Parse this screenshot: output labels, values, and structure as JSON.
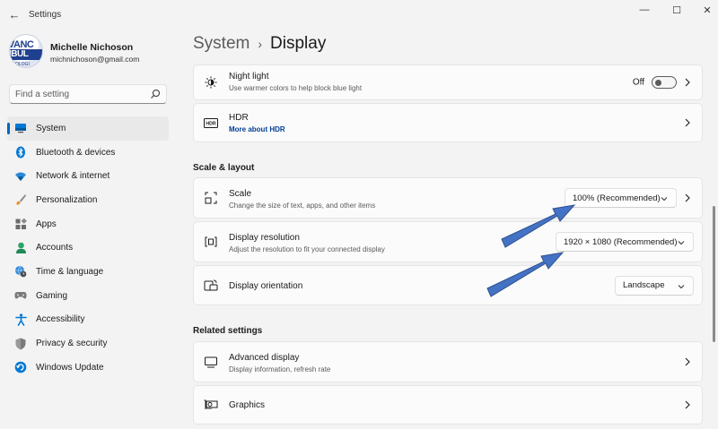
{
  "window": {
    "title": "Settings",
    "back_glyph": "←",
    "minimize_glyph": "—",
    "maximize_glyph": "☐",
    "close_glyph": "✕"
  },
  "profile": {
    "name": "Michelle Nichoson",
    "email": "michnichoson@gmail.com",
    "avatar_line1": "VANC",
    "avatar_line2": "IBUL",
    "avatar_line3": "OLOGI"
  },
  "search": {
    "placeholder": "Find a setting"
  },
  "sidebar": {
    "items": [
      {
        "label": "System",
        "icon": "monitor-icon",
        "active": true
      },
      {
        "label": "Bluetooth & devices",
        "icon": "bluetooth-icon"
      },
      {
        "label": "Network & internet",
        "icon": "wifi-icon"
      },
      {
        "label": "Personalization",
        "icon": "brush-icon"
      },
      {
        "label": "Apps",
        "icon": "apps-icon"
      },
      {
        "label": "Accounts",
        "icon": "person-icon"
      },
      {
        "label": "Time & language",
        "icon": "globe-clock-icon"
      },
      {
        "label": "Gaming",
        "icon": "gamepad-icon"
      },
      {
        "label": "Accessibility",
        "icon": "accessibility-icon"
      },
      {
        "label": "Privacy & security",
        "icon": "shield-icon"
      },
      {
        "label": "Windows Update",
        "icon": "update-icon"
      }
    ]
  },
  "breadcrumb": {
    "parent": "System",
    "separator": "›",
    "current": "Display"
  },
  "cards": {
    "night_light": {
      "title": "Night light",
      "subtitle": "Use warmer colors to help block blue light",
      "state": "Off"
    },
    "hdr": {
      "title": "HDR",
      "link": "More about HDR",
      "icon_text": "HDR"
    },
    "scale": {
      "title": "Scale",
      "subtitle": "Change the size of text, apps, and other items",
      "value": "100% (Recommended)"
    },
    "resolution": {
      "title": "Display resolution",
      "subtitle": "Adjust the resolution to fit your connected display",
      "value": "1920 × 1080 (Recommended)"
    },
    "orientation": {
      "title": "Display orientation",
      "value": "Landscape"
    },
    "advanced": {
      "title": "Advanced display",
      "subtitle": "Display information, refresh rate"
    },
    "graphics": {
      "title": "Graphics"
    }
  },
  "sections": {
    "scale_layout": "Scale & layout",
    "related": "Related settings"
  },
  "colors": {
    "accent": "#0067c0",
    "annotation_arrow": "#4472c4",
    "arrow_outline": "#2f528f"
  }
}
